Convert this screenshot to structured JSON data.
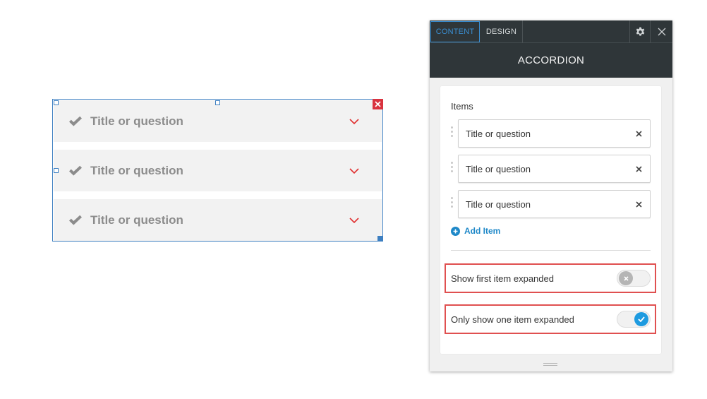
{
  "accordion": {
    "items": [
      {
        "title": "Title or question"
      },
      {
        "title": "Title or question"
      },
      {
        "title": "Title or question"
      }
    ],
    "check_icon": "checkmark-icon",
    "chevron_icon": "chevron-down-icon",
    "chevron_color": "#e03030",
    "delete_icon": "close-icon"
  },
  "panel": {
    "tabs": {
      "content": "CONTENT",
      "design": "DESIGN"
    },
    "title": "ACCORDION",
    "gear_icon": "gear-icon",
    "close_icon": "close-icon",
    "items_label": "Items",
    "items": [
      {
        "value": "Title or question"
      },
      {
        "value": "Title or question"
      },
      {
        "value": "Title or question"
      }
    ],
    "add_item_label": "Add Item",
    "options": {
      "show_first_expanded": {
        "label": "Show first item expanded",
        "enabled": false
      },
      "only_one_expanded": {
        "label": "Only show one item expanded",
        "enabled": true
      }
    },
    "accent_color": "#1e88c8",
    "highlight_color": "#e05050"
  }
}
